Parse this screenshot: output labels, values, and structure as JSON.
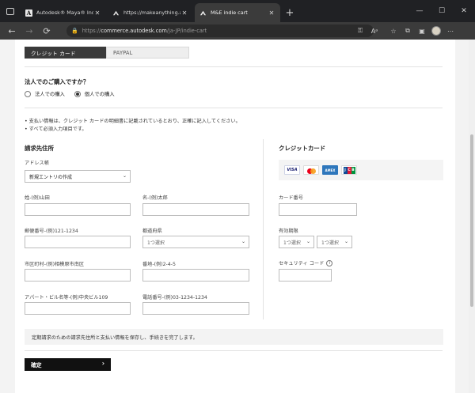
{
  "browser": {
    "tabs": [
      {
        "title": "Autodesk® Maya® Indie, Autodesk",
        "favicon": "autodesk-a-icon",
        "active": false
      },
      {
        "title": "https://makeanything.autodesk.c",
        "favicon": "autodesk-m-icon",
        "active": false
      },
      {
        "title": "M&E indie cart",
        "favicon": "autodesk-m-icon",
        "active": true
      }
    ],
    "new_tab": "+",
    "window_controls": {
      "minimize": "—",
      "maximize": "☐",
      "close": "✕"
    },
    "nav": {
      "back": "←",
      "forward": "→",
      "refresh": "⟳",
      "home": "⌂"
    },
    "url_prefix": "https://",
    "url_host": "commerce.autodesk.com",
    "url_path": "/ja-JP/indie-cart",
    "toolbar_icons": [
      "key-icon",
      "read-aloud-icon",
      "favorite-icon",
      "collections-icon",
      "extensions-icon",
      "profile-avatar",
      "more-icon"
    ]
  },
  "payment_tabs": {
    "credit_card": "クレジット カード",
    "paypal": "PAYPAL"
  },
  "corporate": {
    "question": "法人でのご購入ですか？",
    "options": [
      {
        "label": "法人での購入",
        "selected": false
      },
      {
        "label": "個人での購入",
        "selected": true
      }
    ]
  },
  "notes": [
    "支払い情報は、クレジット カードの明細書に記載されているとおり、正確に記入してください。",
    "すべて必須入力項目です。"
  ],
  "billing": {
    "title": "請求先住所",
    "address_book_label": "アドレス帳",
    "address_book_value": "新規エントリの作成",
    "last_name_label": "姓-(例)山田",
    "first_name_label": "名-(例)太郎",
    "postal_label": "郵便番号-(例)121-1234",
    "prefecture_label": "都道府県",
    "prefecture_value": "1つ選択",
    "city_label": "市区町村-(例)相模原市南区",
    "street_label": "番地-(例)2-4-5",
    "building_label": "アパート・ビル名等-(例)中央ビル109",
    "phone_label": "電話番号-(例)03-1234-1234"
  },
  "credit_card": {
    "title": "クレジットカード",
    "brands": [
      "VISA",
      "Mastercard",
      "AMEX",
      "JCB"
    ],
    "number_label": "カード番号",
    "expiry_label": "有効期限",
    "month_value": "1つ選択",
    "year_value": "1つ選択",
    "cvv_label": "セキュリティ コード",
    "info_glyph": "i"
  },
  "save_notice": "定期請求のための請求先住所と支払い情報を保存し、手続きを完了します。",
  "confirm_label": "確定",
  "confirm_arrow": "›"
}
